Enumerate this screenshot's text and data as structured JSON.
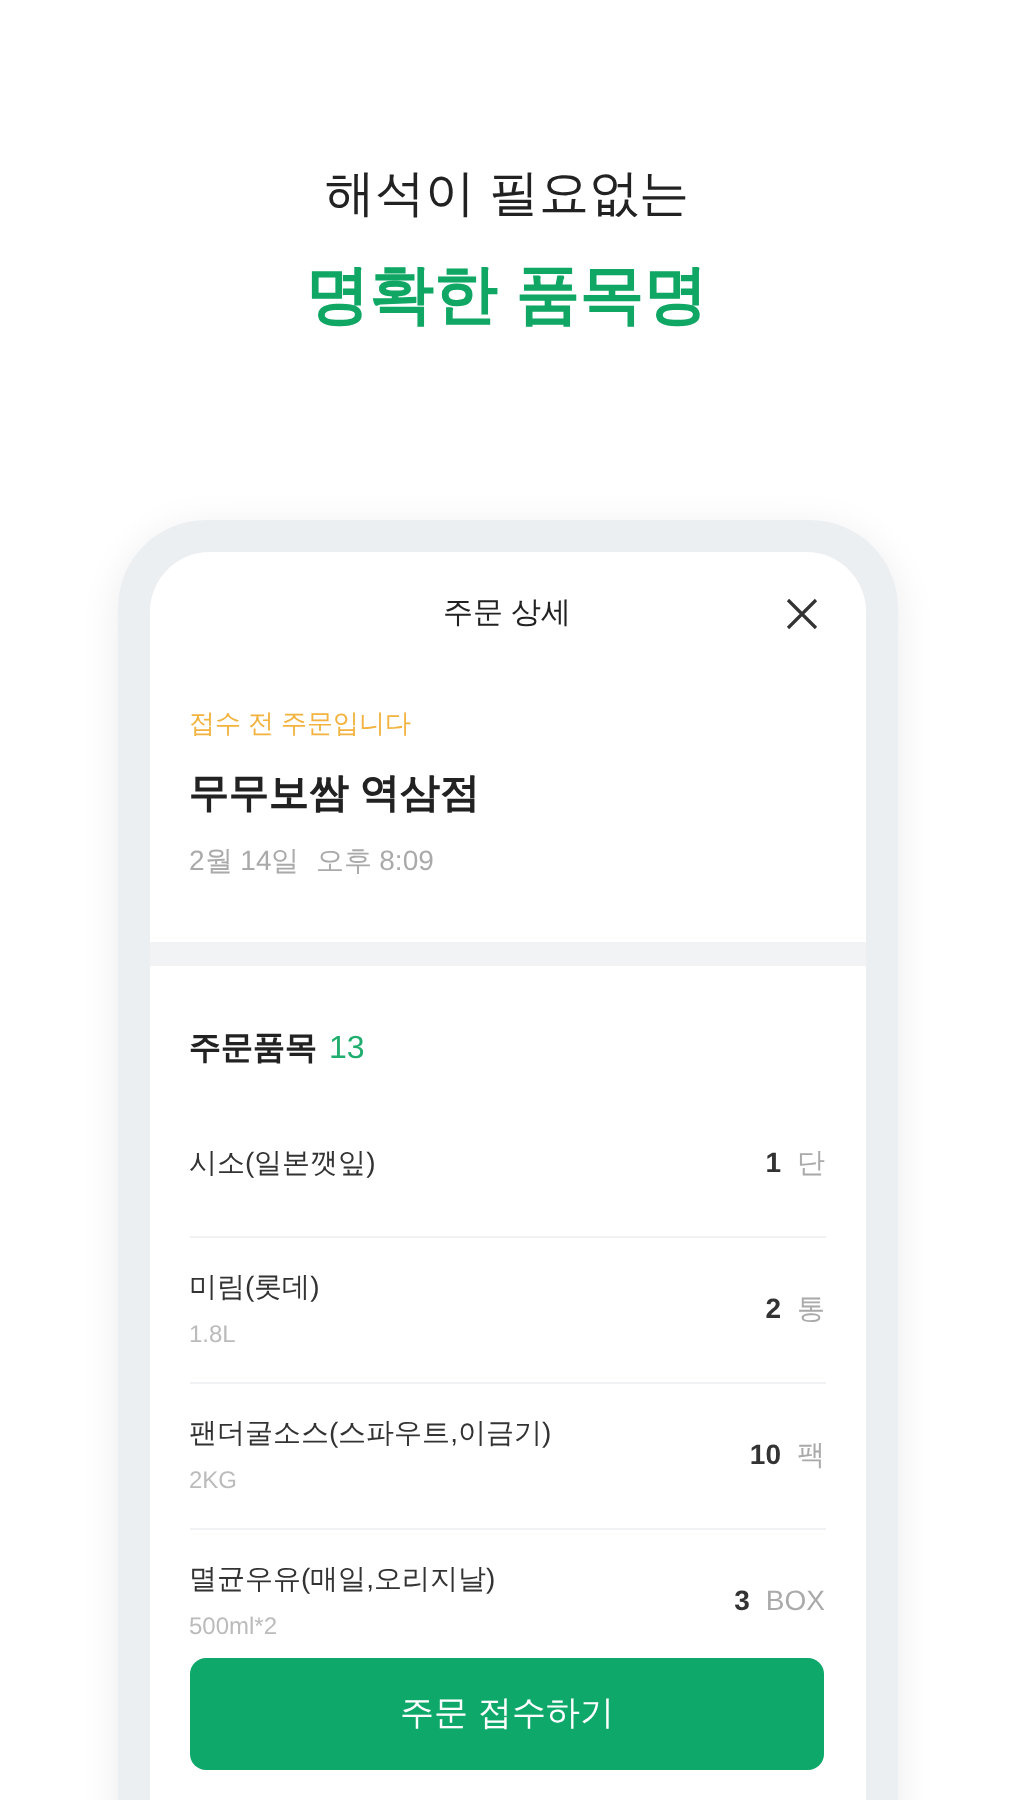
{
  "headline": {
    "subtitle": "해석이 필요없는",
    "title": "명확한 품목명"
  },
  "screen": {
    "title": "주문 상세",
    "status": "접수 전 주문입니다",
    "store": "무무보쌈 역삼점",
    "date": "2월 14일",
    "time": "오후 8:09",
    "items_heading": "주문품목",
    "items_count": "13",
    "items": [
      {
        "name": "시소(일본깻잎)",
        "quantity": "1",
        "unit": "단"
      },
      {
        "name": "미림(롯데)",
        "spec": "1.8L",
        "quantity": "2",
        "unit": "통"
      },
      {
        "name": "팬더굴소스(스파우트,이금기)",
        "spec": "2KG",
        "quantity": "10",
        "unit": "팩"
      },
      {
        "name": "멸균우유(매일,오리지날)",
        "spec": "500ml*2",
        "quantity": "3",
        "unit": "BOX"
      }
    ],
    "accept_button": "주문 접수하기"
  }
}
